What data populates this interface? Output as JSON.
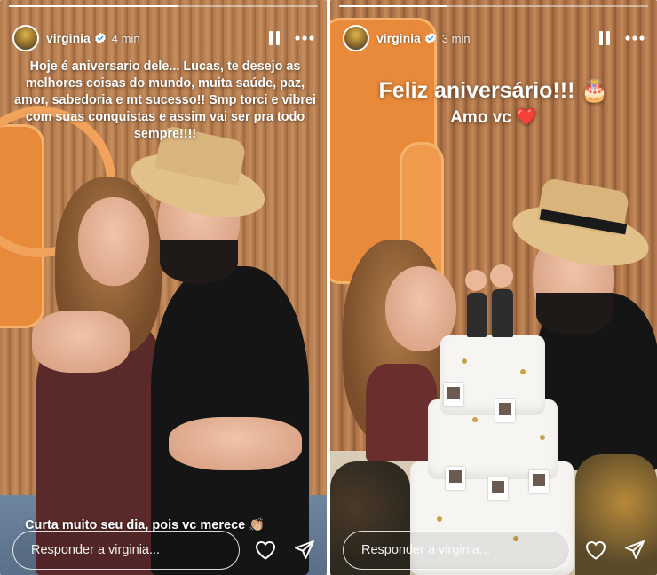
{
  "left_story": {
    "username": "virginia",
    "time": "4 min",
    "caption": "Hoje é aniversario dele... Lucas, te desejo as melhores coisas do mundo, muita saúde, paz, amor, sabedoria e mt sucesso!! Smp torci e vibrei com suas conquistas e assim vai ser pra todo sempre!!!!",
    "bottom_text": "Curta muito seu dia, pois vc merece 👏🏼",
    "reply_placeholder": "Responder a virginia...",
    "progress": 0.55
  },
  "right_story": {
    "username": "virginia",
    "time": "3 min",
    "title": "Feliz aniversário!!! 🎂",
    "subtitle": "Amo vc ❤️",
    "reply_placeholder": "Responder a virginia...",
    "progress": 0.35
  },
  "icons": {
    "verified": "verified-badge-icon",
    "pause": "pause-icon",
    "more": "more-options-icon",
    "heart": "heart-icon",
    "send": "send-icon"
  },
  "colors": {
    "overlay_text": "#ffffff",
    "verified_badge": "#3897f0"
  }
}
